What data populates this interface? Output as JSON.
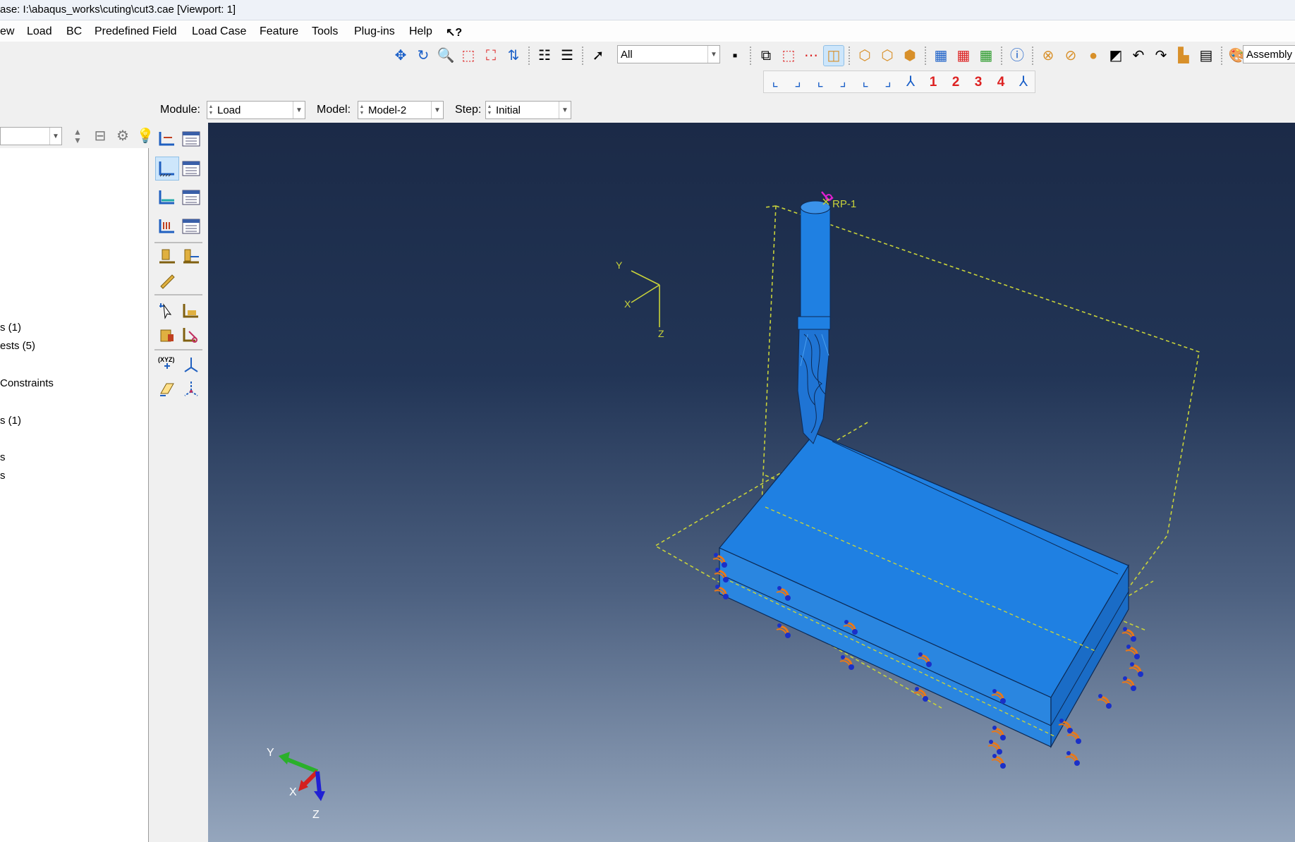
{
  "window": {
    "title": "ase: I:\\abaqus_works\\cuting\\cut3.cae [Viewport: 1]"
  },
  "menu": [
    "ew",
    "Load",
    "BC",
    "Predefined Field",
    "Load Case",
    "Feature",
    "Tools",
    "Plug-ins",
    "Help",
    "?"
  ],
  "toolbar": {
    "selection_filter": "All",
    "assembly_label": "Assembly",
    "view_numbers": [
      "1",
      "2",
      "3",
      "4"
    ]
  },
  "context": {
    "module_label": "Module:",
    "module_value": "Load",
    "model_label": "Model:",
    "model_value": "Model-2",
    "step_label": "Step:",
    "step_value": "Initial"
  },
  "tree": {
    "items": [
      "s (1)",
      "ests (5)",
      "Constraints",
      "s (1)",
      "s",
      "s"
    ]
  },
  "viewport": {
    "rp_label": "RP-1",
    "view_triad": {
      "y": "Y",
      "x": "X",
      "z": "Z"
    },
    "global_triad": {
      "y": "Y",
      "x": "X",
      "z": "Z"
    },
    "colors": {
      "part": "#1f7fe0",
      "bc": "#e8781a",
      "bc_nodes": "#1a30c8",
      "wire": "#c8d23a",
      "rp": "#e020d0"
    }
  }
}
